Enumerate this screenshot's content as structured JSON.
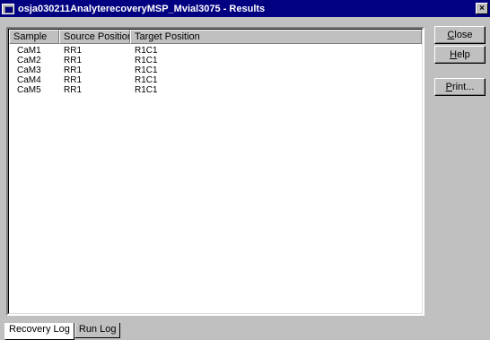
{
  "window": {
    "title": "osja030211AnalyterecoveryMSP_Mvial3075 - Results",
    "close_glyph": "×"
  },
  "table": {
    "columns": [
      "Sample",
      "Source Position",
      "Target Position"
    ],
    "rows": [
      [
        "CaM1",
        "RR1",
        "R1C1"
      ],
      [
        "CaM2",
        "RR1",
        "R1C1"
      ],
      [
        "CaM3",
        "RR1",
        "R1C1"
      ],
      [
        "CaM4",
        "RR1",
        "R1C1"
      ],
      [
        "CaM5",
        "RR1",
        "R1C1"
      ]
    ]
  },
  "buttons": {
    "close": {
      "prefix": "C",
      "rest": "lose"
    },
    "help": {
      "prefix": "H",
      "rest": "elp"
    },
    "print": {
      "prefix": "P",
      "rest": "rint..."
    }
  },
  "tabs": [
    {
      "label": "Recovery Log",
      "active": true
    },
    {
      "label": "Run Log",
      "active": false
    }
  ]
}
